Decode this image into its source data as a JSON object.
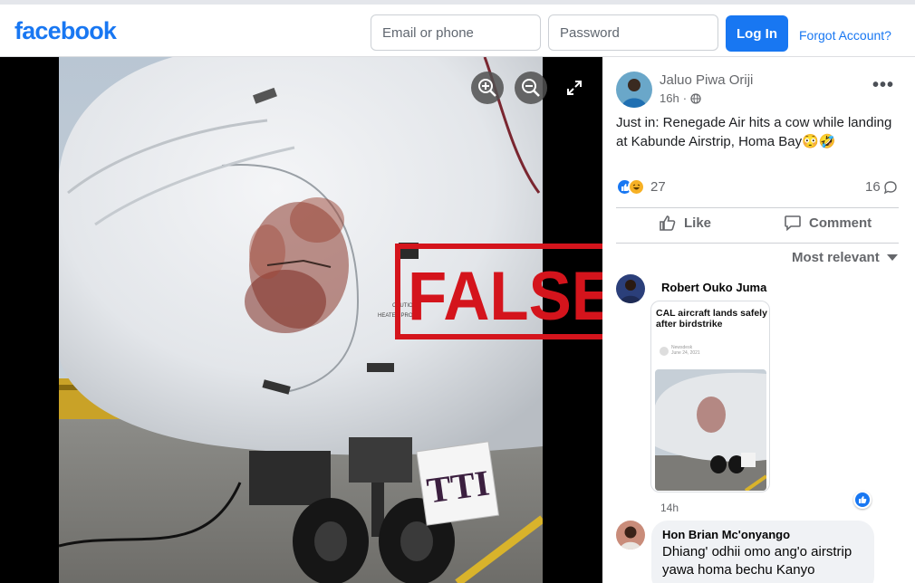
{
  "header": {
    "logo": "facebook",
    "email_placeholder": "Email or phone",
    "password_placeholder": "Password",
    "login_label": "Log In",
    "forgot_label": "Forgot Account?"
  },
  "stamp": {
    "text": "FALSE"
  },
  "photo": {
    "tail_label": "TTI",
    "nose_text": [
      "CAUTION",
      "HEATED PROB"
    ]
  },
  "post": {
    "author": "Jaluo Piwa Oriji",
    "time": "16h",
    "text": "Just in: Renegade Air hits a cow while landing at Kabunde Airstrip, Homa Bay😳🤣",
    "reaction_count": "27",
    "comment_count": "16"
  },
  "actions": {
    "like": "Like",
    "comment": "Comment"
  },
  "sort": {
    "label": "Most relevant"
  },
  "comments": [
    {
      "name": "Robert Ouko Juma",
      "card_headline": "CAL aircraft lands safely after birdstrike",
      "card_source": "Newsdesk",
      "card_date": "June 24, 2021",
      "time": "14h"
    },
    {
      "name": "Hon Brian Mc'onyango",
      "text": "Dhiang' odhii omo ang'o airstrip yawa homa bechu Kanyo"
    }
  ],
  "colors": {
    "brand": "#1877f2",
    "stamp_red": "#d4141c"
  }
}
